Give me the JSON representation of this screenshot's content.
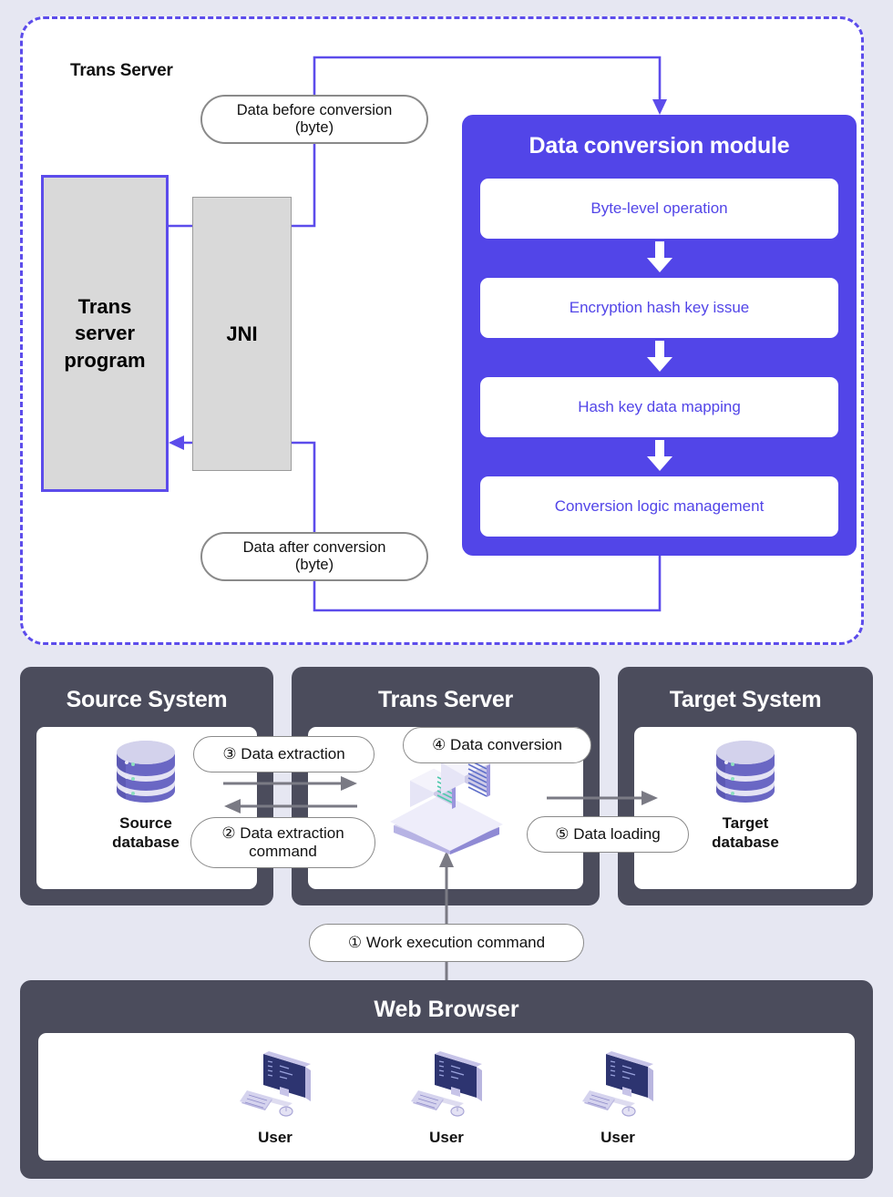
{
  "top_panel": {
    "title": "Trans Server",
    "program_box_label": "Trans\nserver\nprogram",
    "jni_box_label": "JNI",
    "pill_before": "Data before conversion\n(byte)",
    "pill_after": "Data after conversion\n(byte)",
    "module": {
      "title": "Data conversion module",
      "steps": [
        "Byte-level operation",
        "Encryption hash key issue",
        "Hash key data mapping",
        "Conversion logic management"
      ]
    }
  },
  "systems": [
    {
      "title": "Source System",
      "icon_label": "Source\ndatabase",
      "icon": "database-icon"
    },
    {
      "title": "Trans Server",
      "icon_label": "",
      "icon": "server-rack-icon"
    },
    {
      "title": "Target System",
      "icon_label": "Target\ndatabase",
      "icon": "database-icon"
    }
  ],
  "flows": {
    "work_execution": "① Work execution command",
    "data_extraction_command": "② Data extraction\ncommand",
    "data_extraction": "③ Data extraction",
    "data_conversion": "④ Data conversion",
    "data_loading": "⑤ Data loading"
  },
  "web_browser": {
    "title": "Web Browser",
    "users": [
      {
        "label": "User"
      },
      {
        "label": "User"
      },
      {
        "label": "User"
      }
    ]
  },
  "colors": {
    "page_background": "#e6e7f2",
    "accent_purple": "#5245e8",
    "dashed_border": "#5c4ceb",
    "panel_dark": "#4b4c5c",
    "box_gray": "#d9d9d9",
    "arrow_gray": "#7a7a84"
  }
}
